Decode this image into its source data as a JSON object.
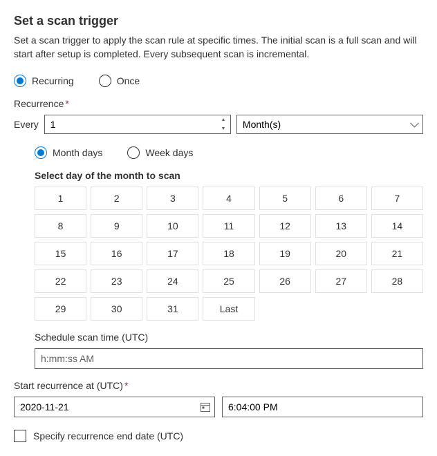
{
  "title": "Set a scan trigger",
  "description": "Set a scan trigger to apply the scan rule at specific times. The initial scan is a full scan and will start after setup is completed. Every subsequent scan is incremental.",
  "trigger_type": {
    "recurring": "Recurring",
    "once": "Once"
  },
  "recurrence_label": "Recurrence",
  "every_label": "Every",
  "every_value": "1",
  "unit_value": "Month(s)",
  "day_type": {
    "month": "Month days",
    "week": "Week days"
  },
  "select_day_label": "Select day of the month to scan",
  "days": [
    "1",
    "2",
    "3",
    "4",
    "5",
    "6",
    "7",
    "8",
    "9",
    "10",
    "11",
    "12",
    "13",
    "14",
    "15",
    "16",
    "17",
    "18",
    "19",
    "20",
    "21",
    "22",
    "23",
    "24",
    "25",
    "26",
    "27",
    "28",
    "29",
    "30",
    "31",
    "Last"
  ],
  "schedule_time_label": "Schedule scan time (UTC)",
  "schedule_time_placeholder": "h:mm:ss AM",
  "start_label": "Start recurrence at (UTC)",
  "start_date": "2020-11-21",
  "start_time": "6:04:00 PM",
  "end_label": "Specify recurrence end date (UTC)"
}
